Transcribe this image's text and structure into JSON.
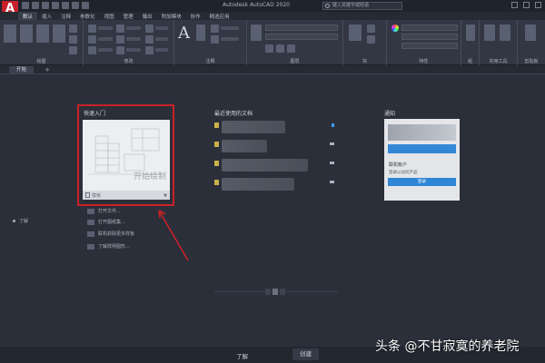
{
  "titlebar": {
    "logo": "A",
    "app_title": "Autodesk AutoCAD 2020",
    "search_placeholder": "键入关键字或短语"
  },
  "menu": {
    "tabs": [
      "默认",
      "插入",
      "注释",
      "参数化",
      "视图",
      "管理",
      "输出",
      "附加模块",
      "协作",
      "精选应用"
    ],
    "active_index": 0
  },
  "ribbon": {
    "panels": [
      "绘图",
      "修改",
      "注释",
      "图层",
      "块",
      "特性",
      "组",
      "实用工具",
      "剪贴板"
    ]
  },
  "file_tab": {
    "label": "开始",
    "add_symbol": "+"
  },
  "start_page": {
    "get_started": {
      "heading": "快速入门",
      "card_text": "开始绘制",
      "template_label": "模板",
      "items": [
        "打开文件...",
        "打开图纸集...",
        "联机获取更多样板",
        "了解样例图形..."
      ]
    },
    "recent": {
      "heading": "最近使用的文档"
    },
    "notices": {
      "heading": "通知",
      "card_title": "联机帐户",
      "card_text": "登录以访问产品",
      "card_button": "登录"
    },
    "learn_link": "了解"
  },
  "bottom_tabs": [
    "了解",
    "创建"
  ],
  "bottom_active_index": 1,
  "watermark": "头条 @不甘寂寞的养老院",
  "colors": {
    "highlight_box": "#c92127",
    "accent_blue": "#2f86d6",
    "background": "#2b2f3a"
  }
}
